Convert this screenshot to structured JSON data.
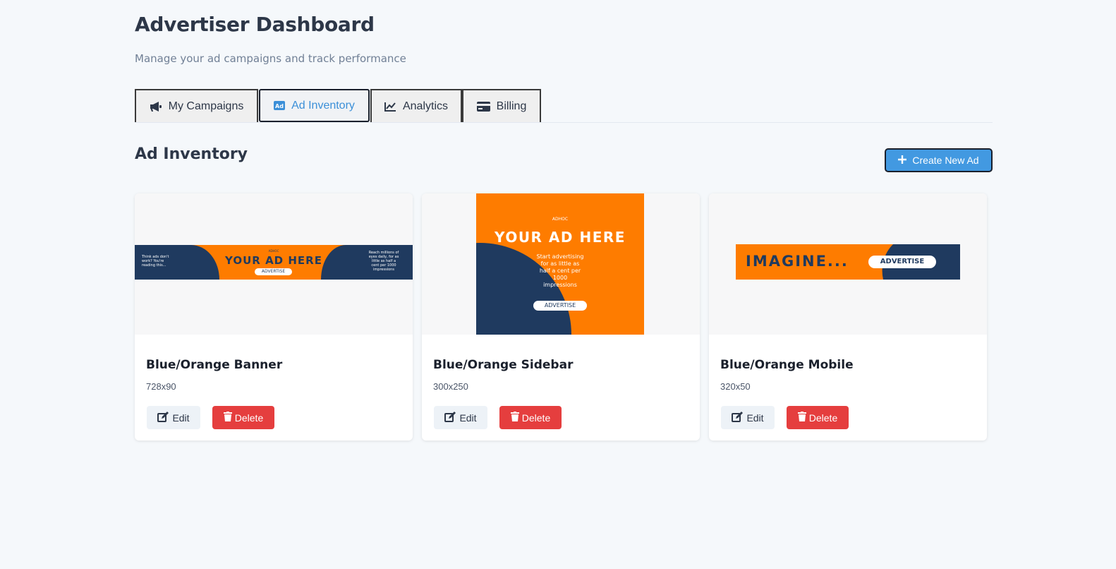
{
  "header": {
    "title": "Advertiser Dashboard",
    "subtitle": "Manage your ad campaigns and track performance"
  },
  "tabs": [
    {
      "label": "My Campaigns",
      "icon": "megaphone-icon",
      "active": false
    },
    {
      "label": "Ad Inventory",
      "icon": "ad-icon",
      "active": true
    },
    {
      "label": "Analytics",
      "icon": "chart-line-icon",
      "active": false
    },
    {
      "label": "Billing",
      "icon": "credit-card-icon",
      "active": false
    }
  ],
  "section": {
    "title": "Ad Inventory",
    "create_label": "Create New Ad"
  },
  "ads": [
    {
      "name": "Blue/Orange Banner",
      "size": "728x90",
      "edit_label": "Edit",
      "delete_label": "Delete",
      "creative": {
        "brand": "ADHOC",
        "headline": "YOUR AD HERE",
        "cta": "ADVERTISE",
        "left_text": "Think ads don't work? You're reading this...",
        "right_text": "Reach millions of eyes daily, for as little as half a cent per 1000 impressions"
      }
    },
    {
      "name": "Blue/Orange Sidebar",
      "size": "300x250",
      "edit_label": "Edit",
      "delete_label": "Delete",
      "creative": {
        "brand": "ADHOC",
        "headline": "YOUR AD HERE",
        "cta": "ADVERTISE",
        "body": "Start advertising for as little as half a cent per 1000 impressions"
      }
    },
    {
      "name": "Blue/Orange Mobile",
      "size": "320x50",
      "edit_label": "Edit",
      "delete_label": "Delete",
      "creative": {
        "headline": "IMAGINE...",
        "cta": "ADVERTISE"
      }
    }
  ],
  "colors": {
    "accent": "#4299e1",
    "danger": "#e53e3e",
    "ad_orange": "#fe7c00",
    "ad_navy": "#1f3a5f"
  }
}
